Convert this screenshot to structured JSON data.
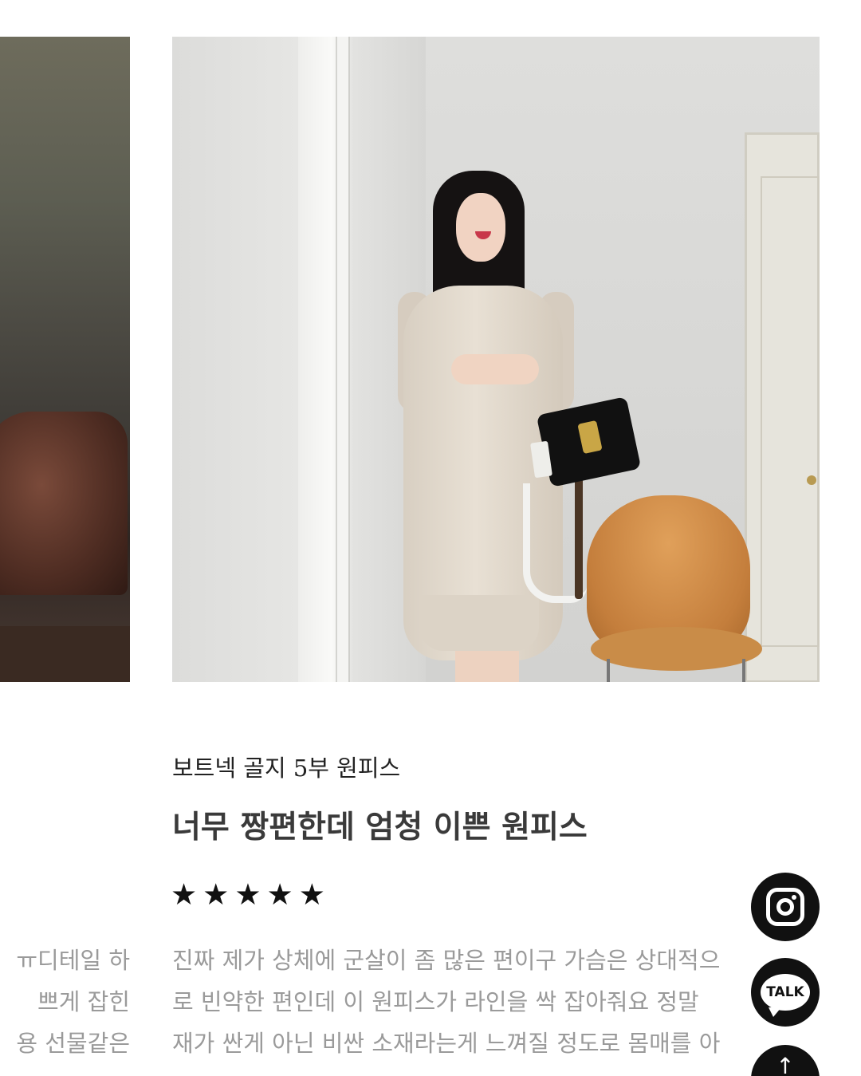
{
  "product": {
    "subtitle": "보트넥 골지 5부 원피스",
    "title": "너무 짱편한데 엄청 이쁜 원피스",
    "rating_stars": [
      "★",
      "★",
      "★",
      "★",
      "★"
    ],
    "rating_value": 5,
    "review_lines": [
      "진짜 제가 상체에 군살이 좀 많은 편이구 가슴은 상대적으",
      "로 빈약한 편인데 이 원피스가 라인을 싹 잡아줘요 정말",
      "재가 싼게 아닌 비싼 소재라는게 느껴질 정도로 몸매를 아"
    ]
  },
  "previous_card": {
    "review_lines": [
      "ㅠ디테일 하",
      "쁘게 잡힌",
      "용 선물같은"
    ]
  },
  "floating_buttons": {
    "instagram_icon": "instagram-icon",
    "talk_label": "TALK",
    "scroll_top_icon": "↑"
  },
  "colors": {
    "review_text": "#9a9a9a",
    "title_text": "#3a3a3a",
    "button_bg": "#111111"
  }
}
